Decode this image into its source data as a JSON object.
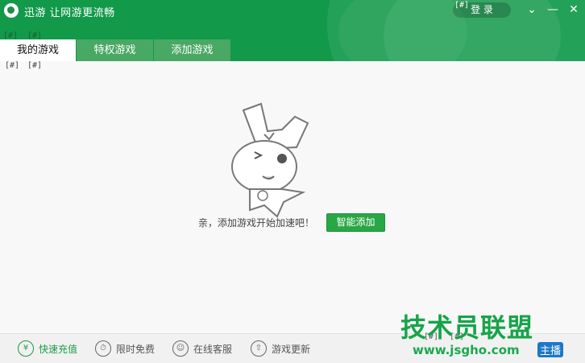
{
  "header": {
    "app_title": "迅游 让网游更流畅",
    "login_label": "登 录",
    "login_placeholder": "[#]",
    "ph_a": "[#]",
    "ph_b": "[#]",
    "minimize": "⌄",
    "min2": "—",
    "close": "✕"
  },
  "tabs": [
    {
      "label": "我的游戏"
    },
    {
      "label": "特权游戏"
    },
    {
      "label": "添加游戏"
    }
  ],
  "under_tabs": {
    "ph_a": "[#]",
    "ph_b": "[#]"
  },
  "main": {
    "empty_message": "亲，添加游戏开始加速吧！",
    "smart_add_label": "智能添加"
  },
  "bottom_bar": {
    "items": [
      {
        "label": "快速充值",
        "icon": "yen-icon",
        "glyph": "¥"
      },
      {
        "label": "限时免费",
        "icon": "stopwatch-icon",
        "glyph": "⏱"
      },
      {
        "label": "在线客服",
        "icon": "user-icon",
        "glyph": "☺"
      },
      {
        "label": "游戏更新",
        "icon": "upload-icon",
        "glyph": "⇧"
      }
    ],
    "ph_a": "[#]",
    "ph_b": "[#]"
  },
  "watermark": {
    "text": "技术员联盟",
    "url": "www.jsgho.com",
    "badge": "主播"
  },
  "colors": {
    "accent": "#12994a",
    "button": "#28a745"
  }
}
